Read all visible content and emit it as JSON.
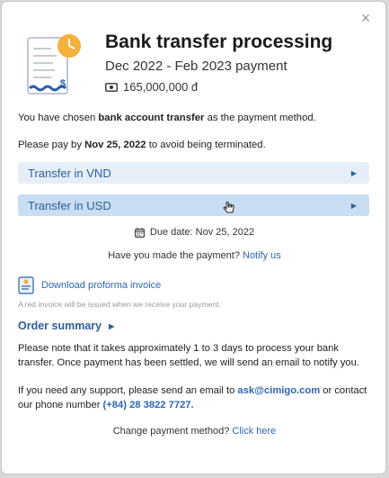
{
  "dialog": {
    "close_icon": "×",
    "title": "Bank transfer processing",
    "subtitle": "Dec 2022 - Feb 2023 payment",
    "amount": "165,000,000 đ"
  },
  "intro": {
    "line1_prefix": "You have chosen ",
    "line1_bold": "bank account transfer",
    "line1_suffix": " as the payment method.",
    "line2_prefix": "Please pay by ",
    "line2_bold": "Nov 25, 2022",
    "line2_suffix": " to avoid being terminated."
  },
  "options": [
    {
      "label": "Transfer in VND",
      "icon": "caret-right-icon"
    },
    {
      "label": "Transfer in USD",
      "icon": "caret-right-icon"
    }
  ],
  "due": {
    "text": "Due date: Nov 25, 2022"
  },
  "payment_made": {
    "question": "Have you made the payment? ",
    "link": "Notify us"
  },
  "download": {
    "label": "Download proforma invoice",
    "note": "A red invoice will be issued when we receive your payment."
  },
  "order_summary": {
    "label": "Order summary"
  },
  "processing_note": "Please note that it takes approximately 1 to 3 days to process your bank transfer.  Once payment has been settled, we will send an email to notify you.",
  "support": {
    "prefix": "If you need any support, please send an email to ",
    "email": "ask@cimigo.com",
    "middle": " or contact our phone number  ",
    "phone": "(+84) 28 3822 7727."
  },
  "change_method": {
    "question": "Change payment method? ",
    "link": "Click here"
  },
  "colors": {
    "accent": "#2d66b3",
    "option_bg": "#e6eff9",
    "option_bg_hover": "#c9ddf3",
    "icon_orange": "#f4b13b",
    "icon_blue": "#2b5fa6"
  }
}
